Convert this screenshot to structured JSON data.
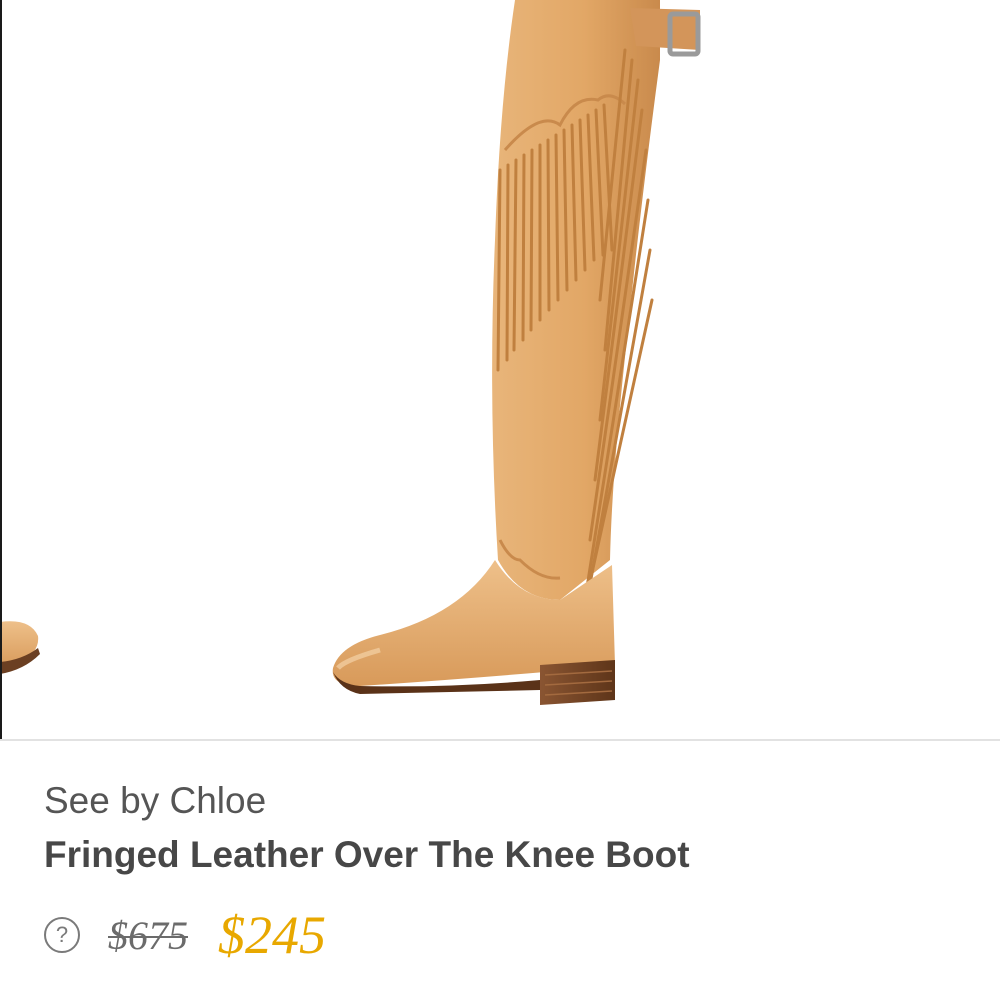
{
  "product": {
    "image_alt": "tan fringed leather over the knee boot",
    "brand": "See by Chloe",
    "name": "Fringed Leather Over The Knee Boot",
    "original_price": "$675",
    "sale_price": "$245",
    "help_icon": "question-circle-icon",
    "help_symbol": "?"
  },
  "colors": {
    "leather": "#e2a766",
    "leather_dark": "#c9874a",
    "heel": "#7a4a2a",
    "sale_price": "#e8a800",
    "text_brand": "#555555",
    "text_name": "#474747"
  }
}
